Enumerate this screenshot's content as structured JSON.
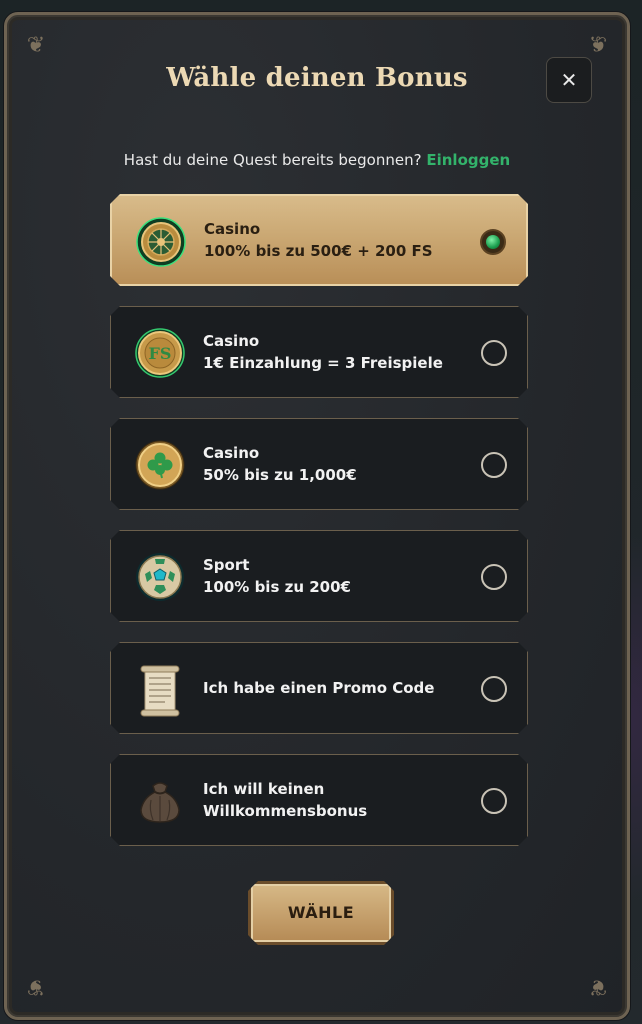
{
  "modal": {
    "title": "Wähle deinen Bonus",
    "close_symbol": "✕",
    "login_prompt": "Hast du deine Quest bereits begonnen?",
    "login_link": "Einloggen"
  },
  "options": [
    {
      "icon": "roulette-icon",
      "line1": "Casino",
      "line2": "100% bis zu 500€ + 200 FS",
      "selected": true
    },
    {
      "icon": "fs-coin-icon",
      "line1": "Casino",
      "line2": "1€ Einzahlung = 3 Freispiele",
      "selected": false
    },
    {
      "icon": "clover-coin-icon",
      "line1": "Casino",
      "line2": "50% bis zu 1,000€",
      "selected": false
    },
    {
      "icon": "soccer-ball-icon",
      "line1": "Sport",
      "line2": "100% bis zu 200€",
      "selected": false
    },
    {
      "icon": "scroll-icon",
      "line1": "Ich habe einen Promo Code",
      "line2": "",
      "selected": false
    },
    {
      "icon": "pouch-icon",
      "line1": "Ich will keinen",
      "line2": "Willkommensbonus",
      "selected": false
    }
  ],
  "choose_button": "WÄHLE",
  "colors": {
    "accent_gold": "#c9a671",
    "link_green": "#33b36b",
    "panel_bg": "#24272b"
  }
}
